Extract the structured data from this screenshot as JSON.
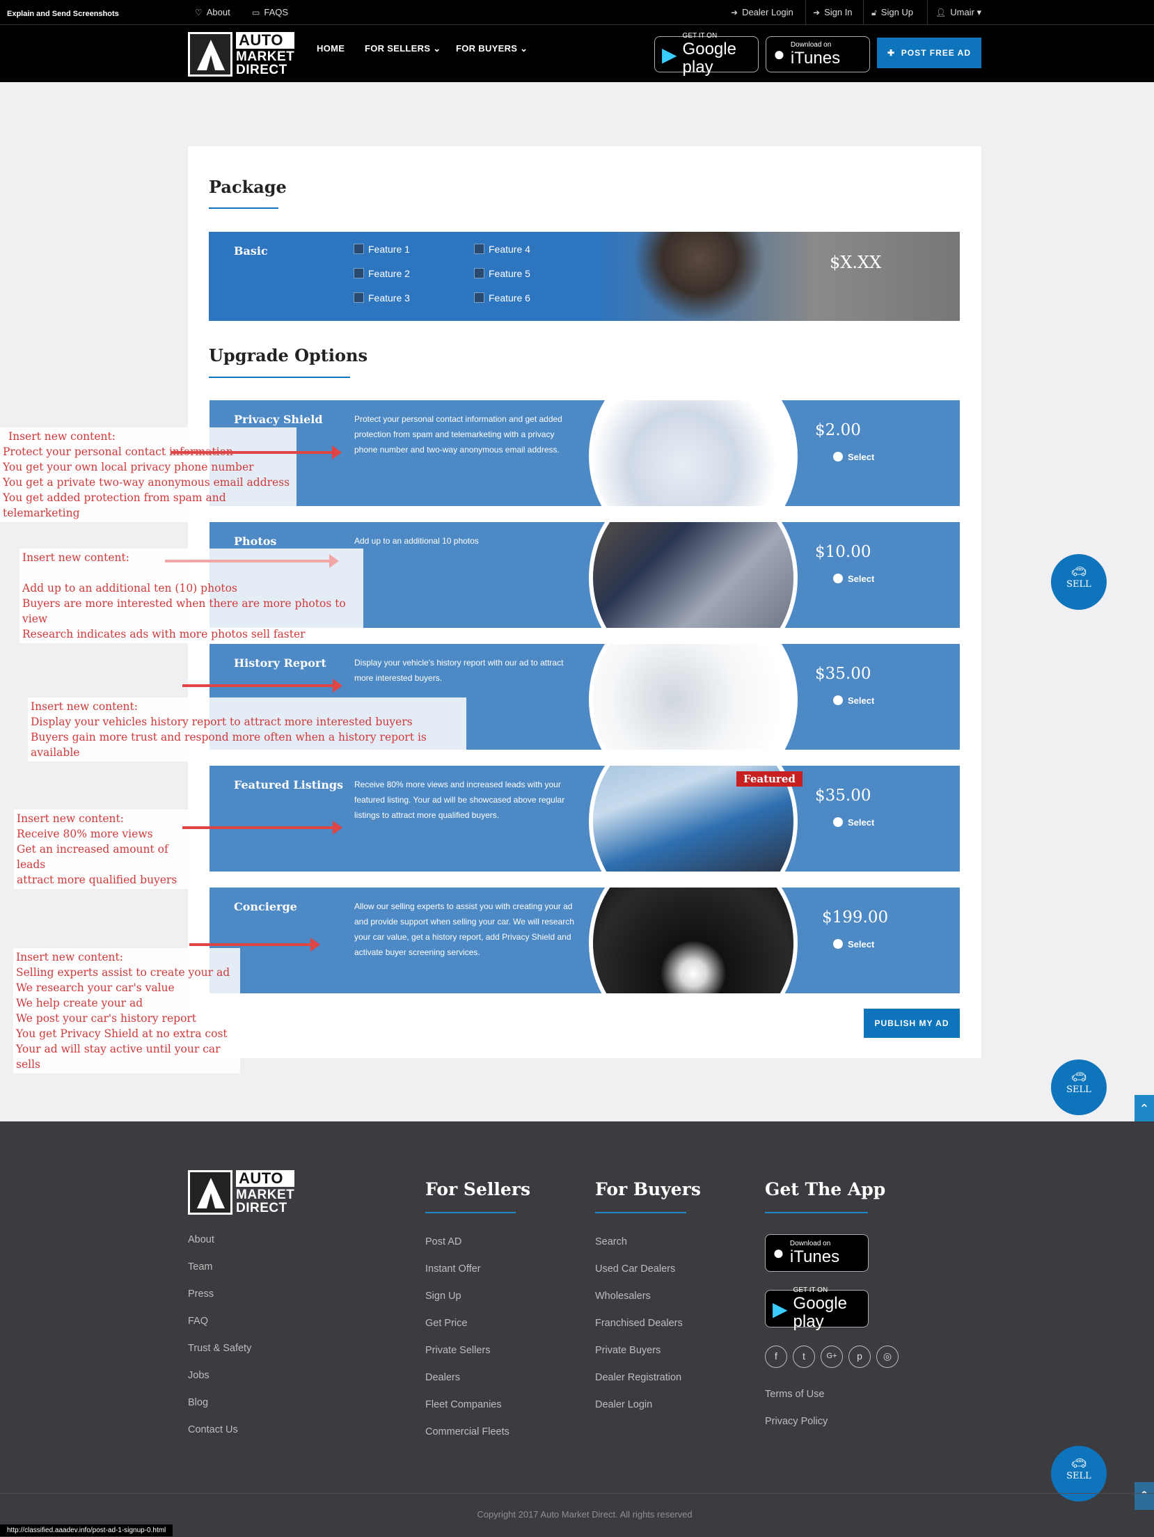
{
  "topbar": {
    "caption": "Explain and Send Screenshots",
    "about": "About",
    "faqs": "FAQS",
    "dealer_login": "Dealer Login",
    "sign_in": "Sign In",
    "sign_up": "Sign Up",
    "user": "Umair"
  },
  "logo": {
    "line1": "AUTO",
    "line2": "MARKET",
    "line3": "DIRECT"
  },
  "nav": {
    "home": "HOME",
    "for_sellers": "FOR SELLERS",
    "for_buyers": "FOR BUYERS"
  },
  "stores": {
    "google_small": "GET IT ON",
    "google_big": "Google play",
    "itunes_small": "Download on",
    "itunes_big": "iTunes"
  },
  "post_free_ad": "POST FREE AD",
  "package": {
    "heading": "Package",
    "name": "Basic",
    "features": [
      "Feature 1",
      "Feature 2",
      "Feature 3",
      "Feature 4",
      "Feature 5",
      "Feature 6"
    ],
    "price": "$X.XX"
  },
  "upgrade": {
    "heading": "Upgrade Options",
    "select_label": "Select",
    "options": [
      {
        "title": "Privacy Shield",
        "desc": "Protect your personal contact information and get added protection from spam and telemarketing with a privacy phone number and two-way anonymous email address.",
        "price": "$2.00"
      },
      {
        "title": "Photos",
        "desc": "Add up to an additional 10 photos",
        "price": "$10.00"
      },
      {
        "title": "History Report",
        "desc": "Display your vehicle's history report with our ad to attract more interested buyers.",
        "price": "$35.00"
      },
      {
        "title": "Featured Listings",
        "desc": "Receive 80% more views and increased leads with your featured listing. Your ad will be showcased above regular listings to attract more qualified buyers.",
        "price": "$35.00",
        "badge": "Featured"
      },
      {
        "title": "Concierge",
        "desc": "Allow our selling experts to assist you with creating your ad and provide support when selling your car. We will research your car value, get a history report, add Privacy Shield and activate buyer screening services.",
        "price": "$199.00"
      }
    ]
  },
  "publish": "PUBLISH MY AD",
  "notes": [
    [
      "Insert new content:",
      "Protect your personal contact information",
      "You get your own local privacy phone number",
      "You get a private two-way anonymous email address",
      "You get added protection from spam and telemarketing"
    ],
    [
      "Insert new content:",
      "",
      "Add up to an additional ten (10) photos",
      "Buyers are more interested when there are more photos to view",
      "Research indicates ads with more photos sell faster"
    ],
    [
      "Insert new content:",
      "Display your vehicles history report to attract more interested buyers",
      "Buyers gain more trust and respond more often when a history report is available"
    ],
    [
      "Insert new content:",
      "Receive 80% more views",
      "Get an increased amount of leads",
      "attract more qualified buyers"
    ],
    [
      "Insert new content:",
      "Selling experts assist to create your ad",
      "We research your car's value",
      "We help create your ad",
      "We post your car's history report",
      "You get Privacy Shield at no extra cost",
      "Your ad will stay active until your car sells"
    ]
  ],
  "sell_label": "SELL",
  "footer": {
    "left_links": [
      "About",
      "Team",
      "Press",
      "FAQ",
      "Trust & Safety",
      "Jobs",
      "Blog",
      "Contact Us"
    ],
    "sellers_heading": "For Sellers",
    "sellers_links": [
      "Post AD",
      "Instant Offer",
      "Sign Up",
      "Get Price",
      "Private Sellers",
      "Dealers",
      "Fleet Companies",
      "Commercial Fleets"
    ],
    "buyers_heading": "For Buyers",
    "buyers_links": [
      "Search",
      "Used Car Dealers",
      "Wholesalers",
      "Franchised Dealers",
      "Private Buyers",
      "Dealer Registration",
      "Dealer Login"
    ],
    "app_heading": "Get The App",
    "social_icons": [
      "facebook-icon",
      "twitter-icon",
      "google-plus-icon",
      "pinterest-icon",
      "instagram-icon"
    ],
    "terms": "Terms of Use",
    "privacy": "Privacy Policy",
    "copyright": "Copyright 2017 Auto Market Direct. All rights reserved"
  },
  "status_url": "http://classified.aaadev.info/post-ad-1-signup-0.html",
  "colors": {
    "accent": "#0e74bb",
    "option_bg": "#4d89c4",
    "annotation": "#d0393a",
    "footer_bg": "#3c3b40"
  }
}
